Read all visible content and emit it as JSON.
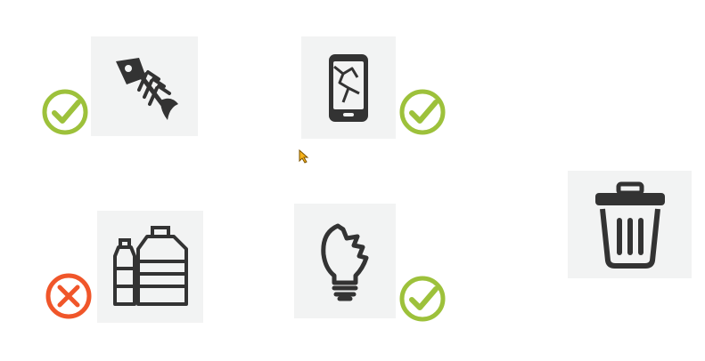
{
  "colors": {
    "tile_background": "#f2f3f3",
    "icon_dark": "#333333",
    "check_green": "#9dc13b",
    "cross_orange": "#f0562a",
    "cursor_fill": "#f6b21a"
  },
  "items": [
    {
      "id": "fish-bone",
      "icon": "fish-bone-icon",
      "status": "check-icon"
    },
    {
      "id": "broken-phone",
      "icon": "broken-phone-icon",
      "status": "check-icon"
    },
    {
      "id": "plastic-bottles",
      "icon": "plastic-bottles-icon",
      "status": "cross-icon"
    },
    {
      "id": "broken-lightbulb",
      "icon": "broken-lightbulb-icon",
      "status": "check-icon"
    }
  ],
  "target": {
    "icon": "trash-bin-icon"
  }
}
